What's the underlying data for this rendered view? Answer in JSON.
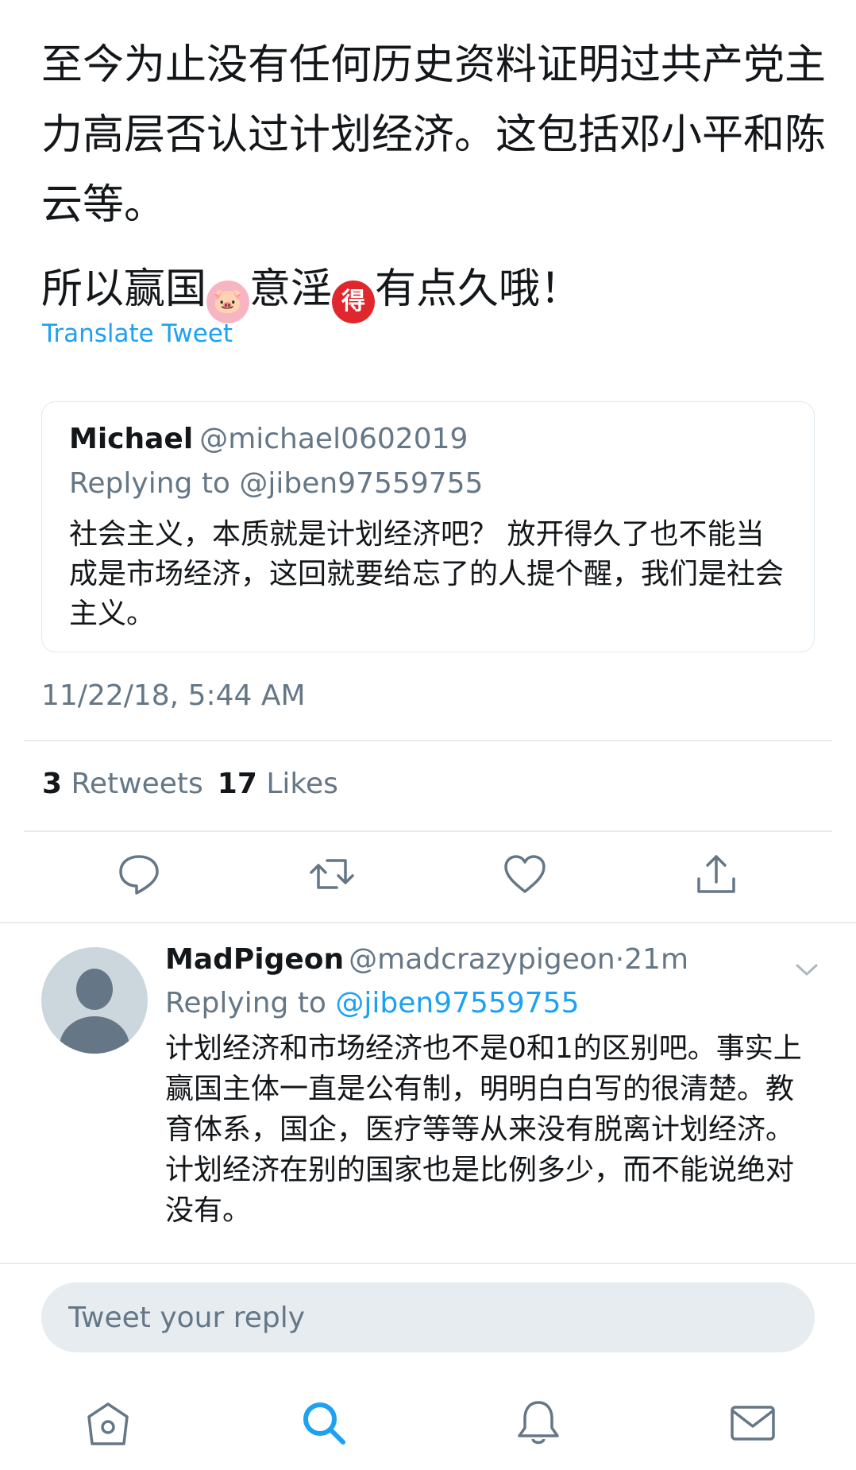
{
  "tweet": {
    "line1": "至今为止没有任何历史资料证明过共产党主力高层否认过计划经济。这包括邓小平和陈云等。",
    "line2_before_pig": "所以赢国",
    "pig_emoji": "🐷",
    "line2_middle": "意淫",
    "de_emoji": "得",
    "line2_after": "有点久哦！"
  },
  "translate_label": "Translate Tweet",
  "quoted": {
    "name": "Michael",
    "handle": "@michael0602019",
    "replying": "Replying to @jiben97559755",
    "body": "社会主义，本质就是计划经济吧？ 放开得久了也不能当成是市场经济，这回就要给忘了的人提个醒，我们是社会主义。"
  },
  "timestamp": "11/22/18, 5:44 AM",
  "stats": {
    "retweets_count": "3",
    "retweets_label": "Retweets",
    "likes_count": "17",
    "likes_label": "Likes"
  },
  "actions": [
    "reply-icon",
    "retweet-icon",
    "like-icon",
    "share-icon"
  ],
  "reply": {
    "name": "MadPigeon",
    "handle": "@madcrazypigeon",
    "separator": "·",
    "time": "21m",
    "replying_prefix": "Replying to",
    "replying_handle": "@jiben97559755",
    "body_p1": "计划经济和市场经济也不是0和1的区别吧。事实上赢国主体一直是公有制，明明白白写的很清楚。教育体系，国企，医疗等等从来没有脱离计划经济。",
    "body_p2": "计划经济在别的国家也是比例多少，而不能说绝对没有。"
  },
  "composer": {
    "placeholder": "Tweet your reply"
  },
  "tabbar": [
    "home-icon",
    "search-icon",
    "notifications-icon",
    "messages-icon"
  ],
  "colors": {
    "accent": "#1da1f2",
    "muted": "#657786",
    "text": "#14171a",
    "border": "#e6ecf0",
    "compose_bg": "#e6ecf0",
    "avatar_bg": "#ccd6dd",
    "avatar_fg": "#657786"
  }
}
